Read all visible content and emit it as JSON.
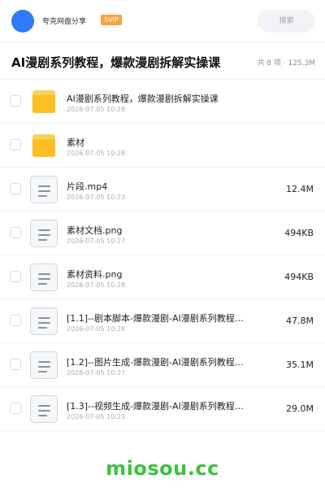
{
  "header": {
    "uploader": "夸克网盘分享",
    "badge": "SVIP",
    "search_placeholder": "搜索"
  },
  "titlebar": {
    "title": "AI漫剧系列教程，爆款漫剧拆解实操课",
    "summary": "共 8 项 · 125.3M"
  },
  "files": [
    {
      "type": "folder",
      "icon": "folder-icon",
      "name": "AI漫剧系列教程，爆款漫剧拆解实操课",
      "date": "2026-07-05 10:28",
      "size": ""
    },
    {
      "type": "folder",
      "icon": "folder-icon",
      "name": "素材",
      "date": "2026-07-05 10:28",
      "size": ""
    },
    {
      "type": "file",
      "icon": "document-icon",
      "name": "片段.mp4",
      "date": "2026-07-05 10:23",
      "size": "12.4M"
    },
    {
      "type": "file",
      "icon": "document-icon",
      "name": "素材文档.png",
      "date": "2026-07-05 10:27",
      "size": "494KB"
    },
    {
      "type": "file",
      "icon": "document-icon",
      "name": "素材资料.png",
      "date": "2026-07-05 10:28",
      "size": "494KB"
    },
    {
      "type": "file",
      "icon": "document-icon",
      "name": "[1.1]--剧本脚本-爆款漫剧-AI漫剧系列教程…",
      "date": "2026-07-05 10:28",
      "size": "47.8M"
    },
    {
      "type": "file",
      "icon": "document-icon",
      "name": "[1.2]--图片生成-爆款漫剧-AI漫剧系列教程…",
      "date": "2026-07-05 10:27",
      "size": "35.1M"
    },
    {
      "type": "file",
      "icon": "document-icon",
      "name": "[1.3]--视频生成-爆款漫剧-AI漫剧系列教程…",
      "date": "2026-07-05 10:23",
      "size": "29.0M"
    }
  ],
  "watermark": "miosou.cc",
  "colors": {
    "accent": "#2f7bf6",
    "svip": "#f7a33b",
    "folder": "#fbbf24",
    "watermark": "#3fc13f"
  }
}
